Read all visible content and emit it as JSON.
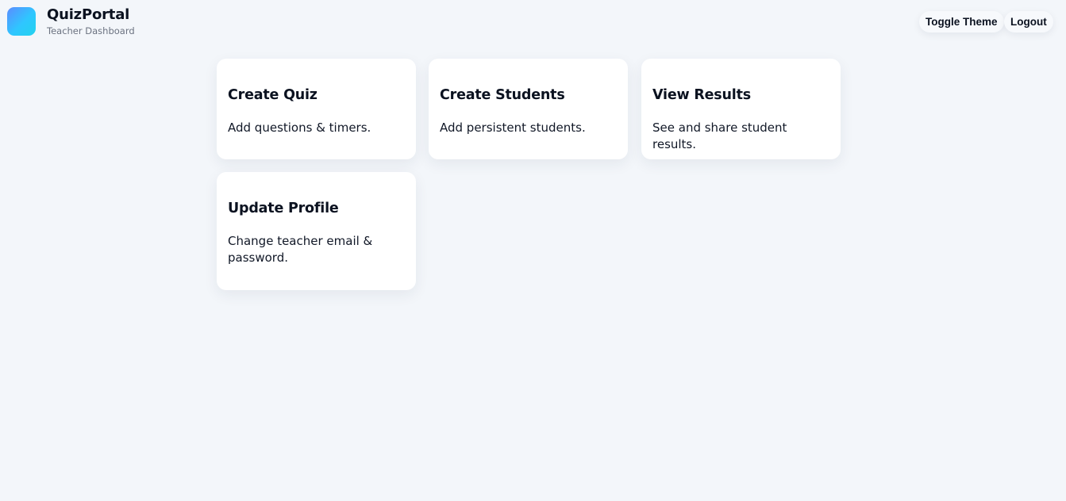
{
  "header": {
    "brand_title": "QuizPortal",
    "brand_subtitle": "Teacher Dashboard",
    "logo_icon": "gradient-square-logo",
    "logo_gradient": [
      "#5b8cff",
      "#22d3ee"
    ],
    "buttons": {
      "toggle_theme": "Toggle Theme",
      "logout": "Logout"
    }
  },
  "cards": [
    {
      "title": "Create Quiz",
      "description": "Add questions & timers."
    },
    {
      "title": "Create Students",
      "description": "Add persistent students."
    },
    {
      "title": "View Results",
      "description": "See and share student results."
    },
    {
      "title": "Update Profile",
      "description": "Change teacher email & password."
    }
  ],
  "colors": {
    "background": "#f3f6fa",
    "card": "#ffffff",
    "text": "#0b1220",
    "muted": "#6b7280"
  }
}
